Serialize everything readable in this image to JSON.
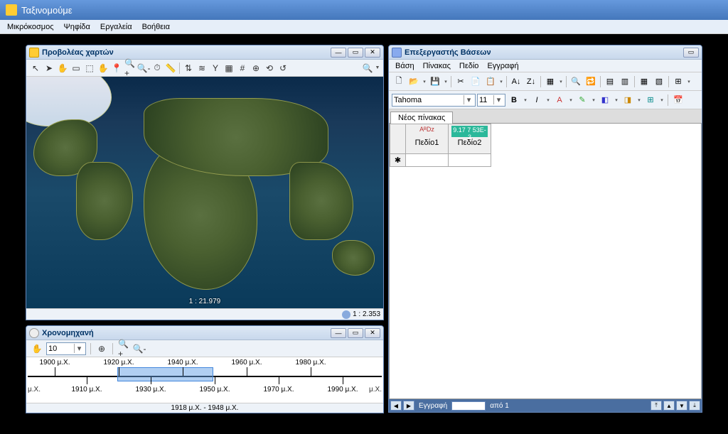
{
  "app": {
    "title": "Ταξινομούμε"
  },
  "mainmenu": [
    "Μικρόκοσμος",
    "Ψηφίδα",
    "Εργαλεία",
    "Βοήθεια"
  ],
  "mapwin": {
    "title": "Προβολέας χαρτών",
    "tools": [
      "↖",
      "➤",
      "✋",
      "▭",
      "⬚",
      "✋",
      "📍",
      "🔍+",
      "🔍-",
      "⏱",
      "📏",
      "⇅",
      "≋",
      "Y",
      "▦",
      "#",
      "⊕",
      "⟲",
      "↺"
    ],
    "search_icon": "🔍",
    "center_scale": "1 : 21.979",
    "status_scale": "1 : 2.353"
  },
  "timewin": {
    "title": "Χρονομηχανή",
    "step_value": "10",
    "tools": [
      "✋",
      "⊕",
      "🔍+",
      "🔍-"
    ],
    "ticks_top": [
      "1900 μ.Χ.",
      "1920 μ.Χ.",
      "1940 μ.Χ.",
      "1960 μ.Χ.",
      "1980 μ.Χ."
    ],
    "ticks_bot": [
      "1910 μ.Χ.",
      "1930 μ.Χ.",
      "1950 μ.Χ.",
      "1970 μ.Χ.",
      "1990 μ.Χ."
    ],
    "edge_left": "μ.Χ.",
    "edge_right": "μ.Χ.",
    "range_label": "1918 μ.Χ. - 1948 μ.Χ."
  },
  "dbwin": {
    "title": "Επεξεργαστής Βάσεων",
    "menu": [
      "Βάση",
      "Πίνακας",
      "Πεδίο",
      "Εγγραφή"
    ],
    "font_name": "Tahoma",
    "font_size": "11",
    "tab": "Νέος πίνακας",
    "fields": [
      {
        "type_label": "AᴮDz",
        "name": "Πεδίο1"
      },
      {
        "type_label": "9.17 7 53E-3",
        "name": "Πεδίο2"
      }
    ],
    "row_marker": "✱",
    "nav": {
      "label": "Εγγραφή",
      "pos": "",
      "total_label": "από 1"
    }
  }
}
